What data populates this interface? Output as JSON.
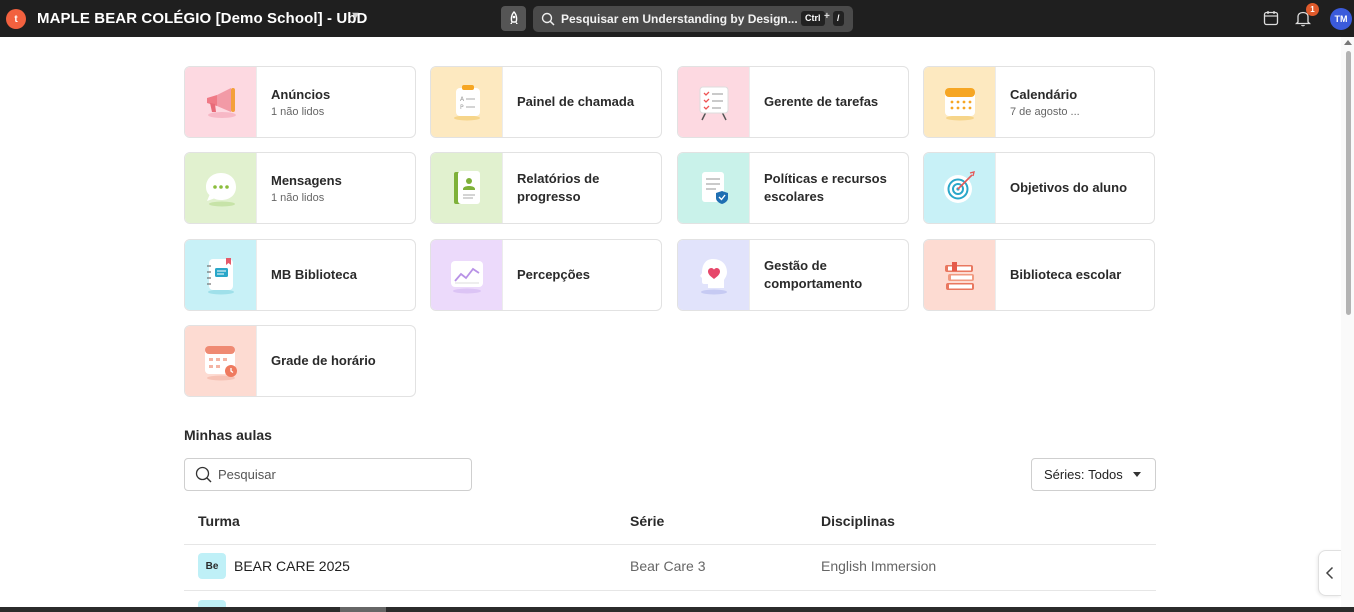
{
  "topbar": {
    "logo_letter": "t",
    "school_name": "MAPLE BEAR COLÉGIO [Demo School] - UbD",
    "search_placeholder": "Pesquisar em Understanding by Design...",
    "shortcut_key1": "Ctrl",
    "shortcut_plus": "+",
    "shortcut_key2": "/",
    "notification_count": "1",
    "avatar_initials": "TM"
  },
  "tiles": [
    {
      "id": "anuncios",
      "title": "Anúncios",
      "sub": "1 não lidos",
      "bg": "#fdd9e1",
      "icon": "megaphone-icon"
    },
    {
      "id": "painel-de-chamada",
      "title": "Painel de chamada",
      "sub": "",
      "bg": "#fde9c0",
      "icon": "attendance-sheet-icon"
    },
    {
      "id": "gerente-de-tarefas",
      "title": "Gerente de tarefas",
      "sub": "",
      "bg": "#fdd9e1",
      "icon": "task-board-icon"
    },
    {
      "id": "calendario",
      "title": "Calendário",
      "sub": "7 de agosto ...",
      "bg": "#fde9c0",
      "icon": "calendar-icon"
    },
    {
      "id": "mensagens",
      "title": "Mensagens",
      "sub": "1 não lidos",
      "bg": "#e1f1cf",
      "icon": "chat-bubble-icon"
    },
    {
      "id": "relatorios-de-progresso",
      "title": "Relatórios de progresso",
      "sub": "",
      "bg": "#e1f1cf",
      "icon": "report-book-icon"
    },
    {
      "id": "politicas-e-recursos",
      "title": "Políticas e recursos escolares",
      "sub": "",
      "bg": "#c9f2ea",
      "icon": "policy-document-icon"
    },
    {
      "id": "objetivos-do-aluno",
      "title": "Objetivos do aluno",
      "sub": "",
      "bg": "#c8f1f7",
      "icon": "target-icon"
    },
    {
      "id": "mb-biblioteca",
      "title": "MB Biblioteca",
      "sub": "",
      "bg": "#c8f1f7",
      "icon": "notebook-icon"
    },
    {
      "id": "percepcoes",
      "title": "Percepções",
      "sub": "",
      "bg": "#ecdafb",
      "icon": "insights-chart-icon"
    },
    {
      "id": "gestao-de-comportamento",
      "title": "Gestão de comportamento",
      "sub": "",
      "bg": "#e1e3fb",
      "icon": "heart-head-icon"
    },
    {
      "id": "biblioteca-escolar",
      "title": "Biblioteca escolar",
      "sub": "",
      "bg": "#fddbd2",
      "icon": "book-stack-icon"
    },
    {
      "id": "grade-de-horario",
      "title": "Grade de horário",
      "sub": "",
      "bg": "#fddbd2",
      "icon": "timetable-icon"
    }
  ],
  "classes": {
    "section_title": "Minhas aulas",
    "search_placeholder": "Pesquisar",
    "series_filter_label": "Séries:",
    "series_filter_value": "Todos",
    "columns": [
      "Turma",
      "Série",
      "Disciplinas"
    ],
    "rows": [
      {
        "badge": "Be",
        "turma": "BEAR CARE 2025",
        "serie": "Bear Care 3",
        "disciplinas": "English Immersion"
      }
    ]
  }
}
